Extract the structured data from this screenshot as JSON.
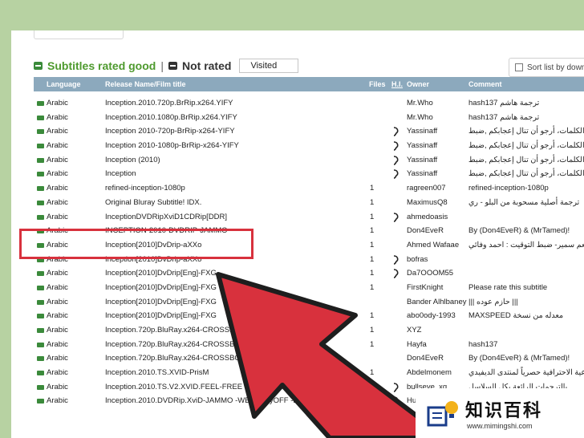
{
  "header": {
    "title_good": "Subtitles rated good",
    "separator": "|",
    "title_bad": "Not rated",
    "visited": "Visited",
    "sort_label": "Sort list by downloads"
  },
  "columns": {
    "language": "Language",
    "release": "Release Name/Film title",
    "files": "Files",
    "hi": "H.I.",
    "owner": "Owner",
    "comment": "Comment"
  },
  "rows": [
    {
      "lang": "Arabic",
      "release": "Inception.2010.720p.BrRip.x264.YIFY",
      "files": "",
      "hi": false,
      "owner": "Mr.Who",
      "comment": "hash137 ترجمة هاشم"
    },
    {
      "lang": "Arabic",
      "release": "Inception.2010.1080p.BrRip.x264.YIFY",
      "files": "",
      "hi": false,
      "owner": "Mr.Who",
      "comment": "hash137 ترجمة هاشم"
    },
    {
      "lang": "Arabic",
      "release": "Inception 2010-720p-BrRip-x264-YIFY",
      "files": "",
      "hi": true,
      "owner": "Yassinaff",
      "comment": "تبسيط الكلمات، أرجو أن تنال إعجابكم ,ضبط"
    },
    {
      "lang": "Arabic",
      "release": "Inception 2010-1080p-BrRip-x264-YIFY",
      "files": "",
      "hi": true,
      "owner": "Yassinaff",
      "comment": "تبسيط الكلمات، أرجو أن تنال إعجابكم ,ضبط"
    },
    {
      "lang": "Arabic",
      "release": "Inception (2010)",
      "files": "",
      "hi": true,
      "owner": "Yassinaff",
      "comment": "تبسيط الكلمات، أرجو أن تنال إعجابكم ,ضبط"
    },
    {
      "lang": "Arabic",
      "release": "Inception",
      "files": "",
      "hi": true,
      "owner": "Yassinaff",
      "comment": "تبسيط الكلمات، أرجو أن تنال إعجابكم ,ضبط"
    },
    {
      "lang": "Arabic",
      "release": "refined-inception-1080p",
      "files": "1",
      "hi": false,
      "owner": "ragreen007",
      "comment": "refined-inception-1080p"
    },
    {
      "lang": "Arabic",
      "release": "Original Bluray Subtitle! IDX.",
      "files": "1",
      "hi": false,
      "owner": "MaximusQ8",
      "comment": "ترجمة أصلية مسحوبة من البلو - ري"
    },
    {
      "lang": "Arabic",
      "release": "InceptionDVDRipXviD1CDRip[DDR]",
      "files": "1",
      "hi": true,
      "owner": "ahmedoasis",
      "comment": ""
    },
    {
      "lang": "Arabic",
      "release": "INCEPTION-2010-DVDRIP-JAMMO",
      "files": "1",
      "hi": false,
      "owner": "Don4EveR",
      "comment": "By (Don4EveR) & (MrTamed)!"
    },
    {
      "lang": "Arabic",
      "release": "Inception[2010]DvDrip-aXXo",
      "files": "1",
      "hi": false,
      "owner": "Ahmed Wafaae",
      "comment": "عبدالمنعم سمير- ضبط التوقيت : احمد وفائي"
    },
    {
      "lang": "Arabic",
      "release": "Inception[2010]DvDrip-aXXo",
      "files": "1",
      "hi": true,
      "owner": "bofras",
      "comment": ""
    },
    {
      "lang": "Arabic",
      "release": "Inception[2010]DvDrip[Eng]-FXG",
      "files": "1",
      "hi": true,
      "owner": "Da7OOOM55",
      "comment": ""
    },
    {
      "lang": "Arabic",
      "release": "Inception[2010]DvDrip[Eng]-FXG",
      "files": "1",
      "hi": false,
      "owner": "FirstKnight",
      "comment": "Please rate this subtitle"
    },
    {
      "lang": "Arabic",
      "release": "Inception[2010]DvDrip[Eng]-FXG",
      "files": "",
      "hi": false,
      "owner": "Bander Alhlbaney",
      "comment": "||| حازم عوده |||"
    },
    {
      "lang": "Arabic",
      "release": "Inception[2010]DvDrip[Eng]-FXG",
      "files": "1",
      "hi": false,
      "owner": "abo0ody-1993",
      "comment": "MAXSPEED معدله من نسخة"
    },
    {
      "lang": "Arabic",
      "release": "Inception.720p.BluRay.x264-CROSSBOW",
      "files": "1",
      "hi": false,
      "owner": "XYZ",
      "comment": ""
    },
    {
      "lang": "Arabic",
      "release": "Inception.720p.BluRay.x264-CROSSBOW",
      "files": "1",
      "hi": false,
      "owner": "Hayfa",
      "comment": "hash137"
    },
    {
      "lang": "Arabic",
      "release": "Inception.720p.BluRay.x264-CROSSBOW",
      "files": "",
      "hi": false,
      "owner": "Don4EveR",
      "comment": "By (Don4EveR) & (MrTamed)!"
    },
    {
      "lang": "Arabic",
      "release": "Inception.2010.TS.XVID-PrisM",
      "files": "1",
      "hi": false,
      "owner": "Abdelmonem",
      "comment": "السماعية الاحترافية حصرياً لمنتدى الديفيدي"
    },
    {
      "lang": "Arabic",
      "release": "Inception.2010.TS.V2.XVID.FEEL-FREE",
      "files": "1",
      "hi": true,
      "owner": "bullseye_xq",
      "comment": "بالترجمات الرائعة بكل السلاسل"
    },
    {
      "lang": "Arabic",
      "release": "Inception.2010.DVDRip.XviD-JAMMO -WBZ -playOFF -BO",
      "files": "1",
      "hi": true,
      "owner": "Hu",
      "comment": ""
    }
  ],
  "watermark": {
    "text": "知识百科",
    "url": "www.mimingshi.com"
  },
  "colors": {
    "accent_green": "#4e9a2e",
    "table_header": "#8ca9bd",
    "highlight_red": "#d8313d",
    "background": "#b7d2a2"
  }
}
